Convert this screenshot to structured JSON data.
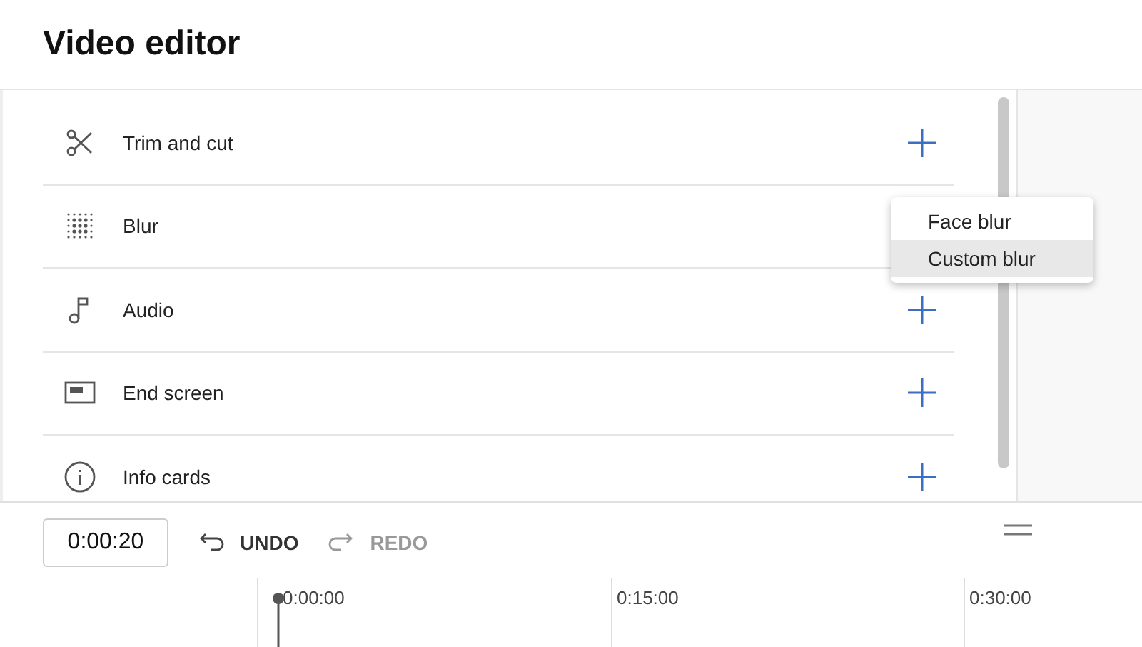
{
  "window": {
    "title": "Video editor"
  },
  "tools": [
    {
      "label": "Trim and cut"
    },
    {
      "label": "Blur",
      "menu": {
        "items": [
          {
            "label": "Face blur",
            "selected": false
          },
          {
            "label": "Custom blur",
            "selected": true
          }
        ]
      }
    },
    {
      "label": "Audio"
    },
    {
      "label": "End screen"
    },
    {
      "label": "Info cards"
    }
  ],
  "toolbar": {
    "time": "0:00:20",
    "undo": {
      "label": "UNDO",
      "disabled": false
    },
    "redo": {
      "label": "REDO",
      "disabled": true
    }
  },
  "timeline": {
    "ticks": [
      "0:00:00",
      "0:15:00",
      "0:30:00"
    ]
  }
}
